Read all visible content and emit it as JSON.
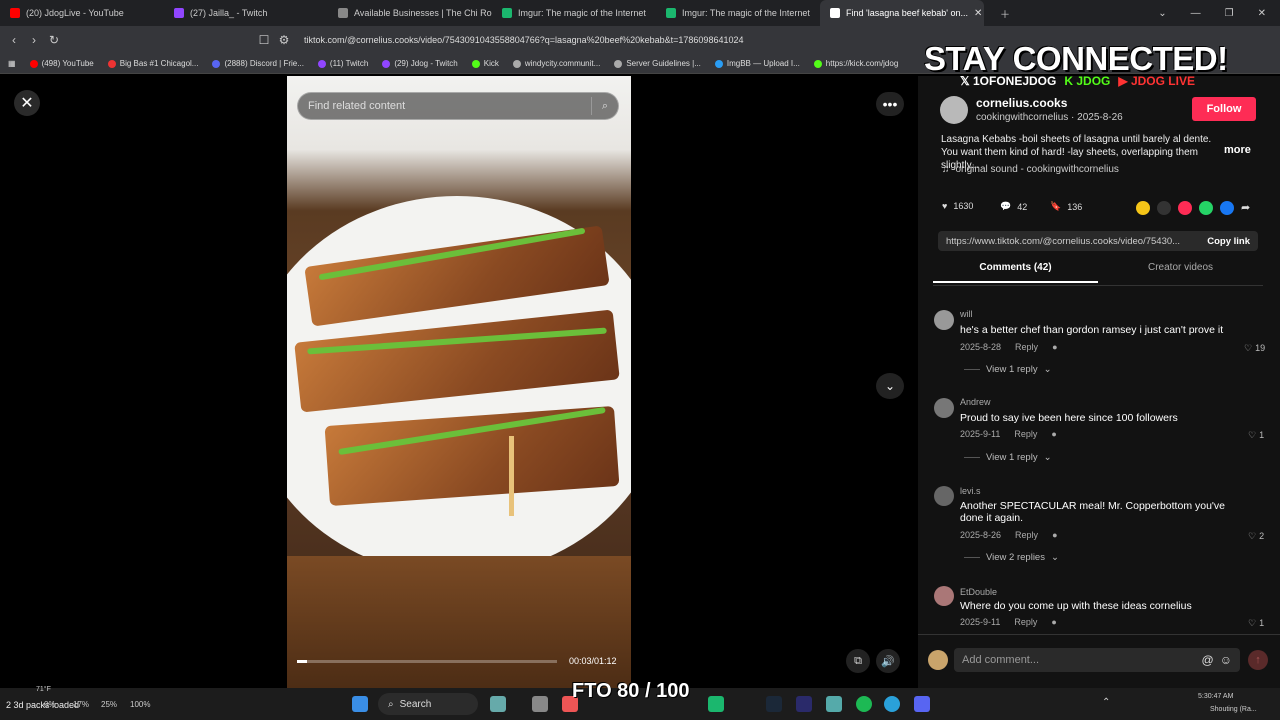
{
  "browser": {
    "tabs": [
      {
        "label": "(20) JdogLive - YouTube",
        "color": "#ff0000"
      },
      {
        "label": "(27) Jailla_ - Twitch",
        "color": "#9146ff"
      },
      {
        "label": "Available Businesses | The Chi Rolepl...",
        "color": "#888888"
      },
      {
        "label": "Imgur: The magic of the Internet",
        "color": "#1bb76e"
      },
      {
        "label": "Imgur: The magic of the Internet",
        "color": "#1bb76e"
      },
      {
        "label": "Find 'lasagna beef kebab' on...",
        "color": "#ffffff"
      }
    ],
    "url": "tiktok.com/@cornelius.cooks/video/7543091043558804766?q=lasagna%20beef%20kebab&t=1786098641024",
    "bookmarks": [
      {
        "label": "(498) YouTube",
        "color": "#ff0000"
      },
      {
        "label": "Big Bas #1 Chicagol...",
        "color": "#e33"
      },
      {
        "label": "(2888) Discord | Frie...",
        "color": "#5865f2"
      },
      {
        "label": "(11) Twitch",
        "color": "#9146ff"
      },
      {
        "label": "(29) Jdog - Twitch",
        "color": "#9146ff"
      },
      {
        "label": "Kick",
        "color": "#53fc18"
      },
      {
        "label": "windycity.communit...",
        "color": "#aaa"
      },
      {
        "label": "Server Guidelines |...",
        "color": "#aaa"
      },
      {
        "label": "ImgBB — Upload I...",
        "color": "#2a9df4"
      },
      {
        "label": "https://kick.com/jdog",
        "color": "#53fc18"
      }
    ]
  },
  "overlay": {
    "stay_connected": "STAY CONNECTED!",
    "social_x": "𝕏 1OFONEJDOG",
    "social_kick": "K JDOG",
    "social_yt": "▶ JDOG LIVE",
    "fto": "FTO 80 / 100"
  },
  "video": {
    "search_placeholder": "Find related content",
    "time": "00:03/01:12",
    "progress": 0.04
  },
  "post": {
    "username": "cornelius.cooks",
    "subline": "cookingwithcornelius · 2025-8-26",
    "follow_label": "Follow",
    "description": "Lasagna Kebabs -boil sheets of lasagna until barely al dente. You want them kind of hard! -lay sheets, overlapping them slightly...",
    "more_label": "more",
    "sound": "original sound - cookingwithcornelius",
    "likes": "1630",
    "comments": "42",
    "saves": "136",
    "link": "https://www.tiktok.com/@cornelius.cooks/video/75430...",
    "copy_label": "Copy link",
    "tab_comments": "Comments (42)",
    "tab_creator": "Creator videos",
    "add_comment_placeholder": "Add comment..."
  },
  "comments": [
    {
      "user": "will",
      "text": "he's a better chef than gordon ramsey i just can't prove it",
      "date": "2025-8-28",
      "reply": "Reply",
      "likes": "19",
      "view_replies": "View 1 reply"
    },
    {
      "user": "Andrew",
      "text": "Proud to say ive been here since 100 followers",
      "date": "2025-9-11",
      "reply": "Reply",
      "likes": "1",
      "view_replies": "View 1 reply"
    },
    {
      "user": "levi.s",
      "text": "Another SPECTACULAR meal! Mr. Copperbottom you've done it again.",
      "date": "2025-8-26",
      "reply": "Reply",
      "likes": "2",
      "view_replies": "View 2 replies"
    },
    {
      "user": "EtDouble",
      "text": "Where do you come up with these ideas cornelius",
      "date": "2025-9-11",
      "reply": "Reply",
      "likes": "1",
      "view_replies": ""
    }
  ],
  "taskbar": {
    "search_label": "Search",
    "weather": "71°F",
    "stats": [
      "0%",
      "17%",
      "25%",
      "100%"
    ],
    "left_text": "2 3d packs loaded",
    "clock": "5:30:47 AM",
    "right_text": "Shouting (Ra..."
  }
}
